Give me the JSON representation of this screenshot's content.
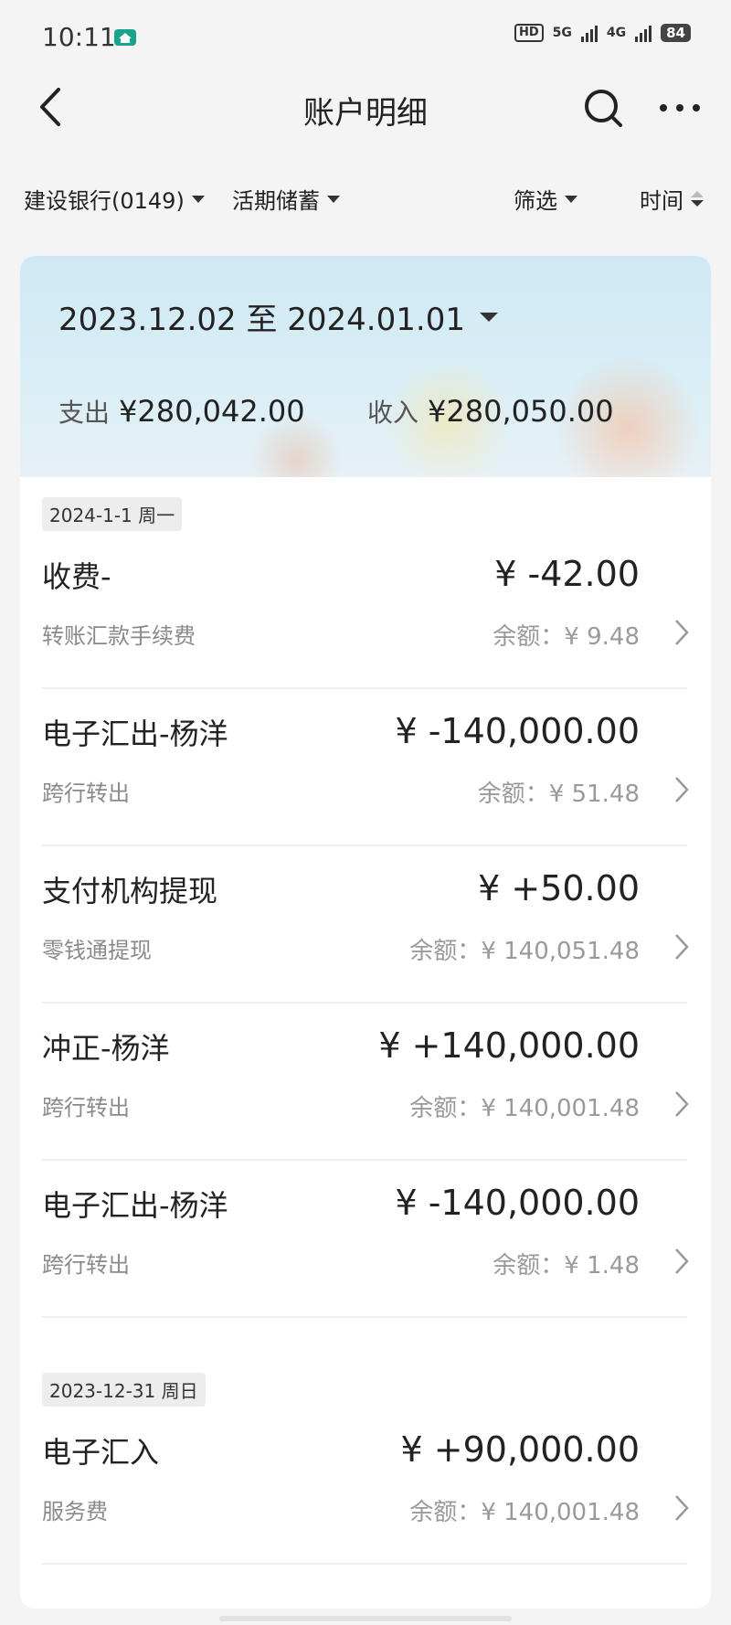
{
  "status_bar": {
    "time": "10:11",
    "app_icon": "house-app-icon",
    "hd_label": "HD",
    "hd_sub": "1 2",
    "net_5g": "5G",
    "net_4g": "4G",
    "battery": "84"
  },
  "nav": {
    "title": "账户明细",
    "back_icon": "chevron-left-icon",
    "search_icon": "search-icon",
    "more_icon": "more-horizontal-icon"
  },
  "filters": {
    "account": "建设银行(0149)",
    "account_type": "活期储蓄",
    "filter": "筛选",
    "sort": "时间"
  },
  "summary": {
    "date_range": "2023.12.02 至 2024.01.01",
    "expense_label": "支出",
    "expense_value": "¥280,042.00",
    "income_label": "收入",
    "income_value": "¥280,050.00"
  },
  "groups": [
    {
      "date": "2024-1-1 周一",
      "transactions": [
        {
          "title": "收费-",
          "amount": "¥ -42.00",
          "subtitle": "转账汇款手续费",
          "balance": "余额：¥ 9.48"
        },
        {
          "title": "电子汇出-杨洋",
          "amount": "¥ -140,000.00",
          "subtitle": "跨行转出",
          "balance": "余额：¥ 51.48"
        },
        {
          "title": "支付机构提现",
          "amount": "¥ +50.00",
          "subtitle": "零钱通提现",
          "balance": "余额：¥ 140,051.48"
        },
        {
          "title": "冲正-杨洋",
          "amount": "¥ +140,000.00",
          "subtitle": "跨行转出",
          "balance": "余额：¥ 140,001.48"
        },
        {
          "title": "电子汇出-杨洋",
          "amount": "¥ -140,000.00",
          "subtitle": "跨行转出",
          "balance": "余额：¥ 1.48"
        }
      ]
    },
    {
      "date": "2023-12-31 周日",
      "transactions": [
        {
          "title": "电子汇入",
          "amount": "¥ +90,000.00",
          "subtitle": "服务费",
          "balance": "余额：¥ 140,001.48"
        }
      ]
    }
  ]
}
